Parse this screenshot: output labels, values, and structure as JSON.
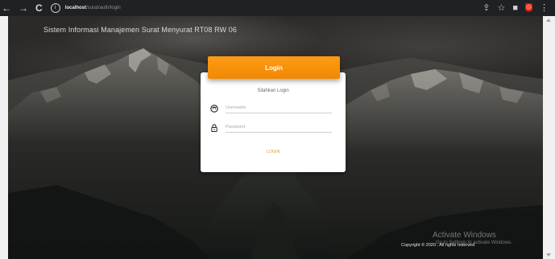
{
  "browser": {
    "url_host": "localhost",
    "url_path": "/surat/auth/login",
    "nav": {
      "back": "←",
      "forward": "→",
      "reload": "C"
    },
    "info_glyph": "i",
    "actions": {
      "share": "⇪",
      "star": "☆",
      "window": "■",
      "menu": "⋮"
    }
  },
  "page": {
    "system_title": "Sistem Informasi Manajemen Surat Menyurat RT08 RW 06",
    "accent_color": "#f39a1b"
  },
  "login": {
    "header": "Login",
    "subtitle": "Silahkan Login",
    "username": {
      "placeholder": "Username",
      "value": "",
      "icon": "user-icon"
    },
    "password": {
      "placeholder": "Password",
      "value": "",
      "icon": "lock-icon"
    },
    "button": "LOGIN"
  },
  "footer": {
    "copyright": "Copyright © 2020 . All rights reserved"
  },
  "watermark": {
    "title": "Activate Windows",
    "subtitle": "Go to Settings to activate Windows."
  }
}
